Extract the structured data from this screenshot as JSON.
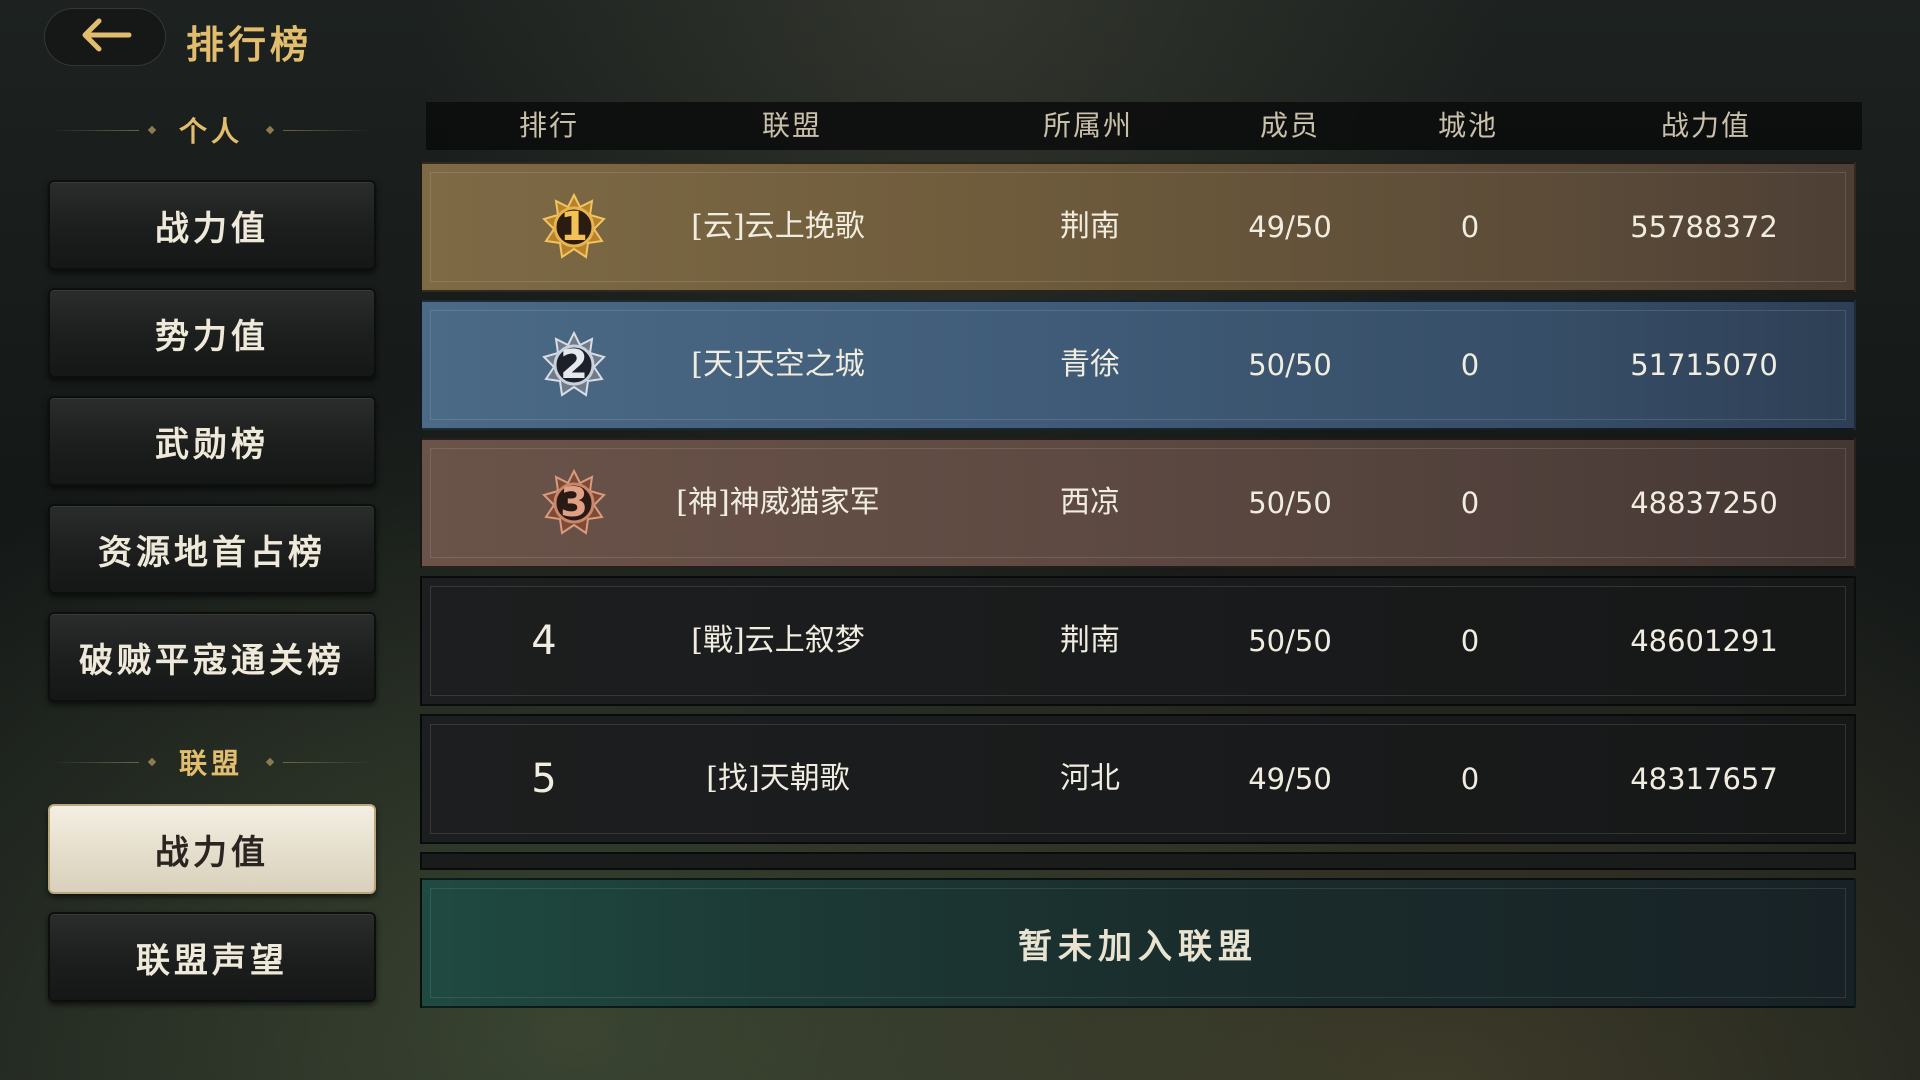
{
  "header": {
    "title": "排行榜",
    "back_icon": "arrow-left-icon"
  },
  "sidebar": {
    "personal_label": "个人",
    "personal_items": [
      {
        "label": "战力值"
      },
      {
        "label": "势力值"
      },
      {
        "label": "武勋榜"
      },
      {
        "label": "资源地首占榜"
      },
      {
        "label": "破贼平寇通关榜"
      }
    ],
    "alliance_label": "联盟",
    "alliance_items": [
      {
        "label": "战力值",
        "active": true
      },
      {
        "label": "联盟声望"
      }
    ]
  },
  "table": {
    "headers": {
      "rank": "排行",
      "alliance": "联盟",
      "state": "所属州",
      "members": "成员",
      "cities": "城池",
      "power": "战力值"
    },
    "rows": [
      {
        "rank": "1",
        "alliance": "[云]云上挽歌",
        "state": "荆南",
        "members": "49/50",
        "cities": "0",
        "power": "55788372"
      },
      {
        "rank": "2",
        "alliance": "[天]天空之城",
        "state": "青徐",
        "members": "50/50",
        "cities": "0",
        "power": "51715070"
      },
      {
        "rank": "3",
        "alliance": "[神]神威猫家军",
        "state": "西凉",
        "members": "50/50",
        "cities": "0",
        "power": "48837250"
      },
      {
        "rank": "4",
        "alliance": "[戰]云上叙梦",
        "state": "荆南",
        "members": "50/50",
        "cities": "0",
        "power": "48601291"
      },
      {
        "rank": "5",
        "alliance": "[找]天朝歌",
        "state": "河北",
        "members": "49/50",
        "cities": "0",
        "power": "48317657"
      }
    ],
    "medal_colors": {
      "gold": "#d9a23c",
      "silver": "#c9d2dc",
      "bronze": "#b97458"
    }
  },
  "my_alliance": {
    "status": "暂未加入联盟"
  }
}
